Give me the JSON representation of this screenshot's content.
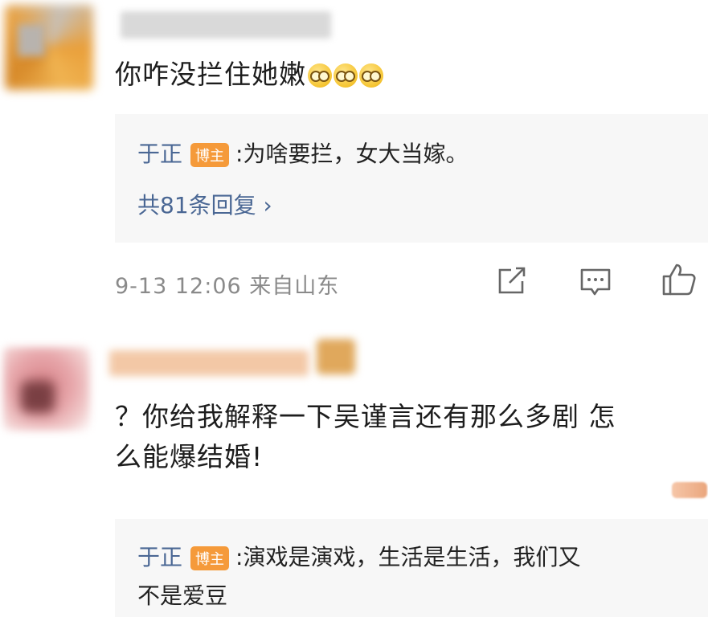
{
  "comment1": {
    "text": "你咋没拦住她嫩",
    "emoji_count": 3,
    "reply": {
      "author": "于正",
      "tag": "博主",
      "text": ":为啥要拦，女大当嫁。"
    },
    "more_replies": "共81条回复 ›",
    "timestamp": "9-13 12:06 来自山东"
  },
  "comment2": {
    "line1": "？你给我解释一下吴谨言还有那么多剧 怎",
    "line2": "么能爆结婚!",
    "reply": {
      "author": "于正",
      "tag": "博主",
      "line1": ":演戏是演戏，生活是生活，我们又",
      "line2": "不是爱豆"
    }
  },
  "icons": [
    "share-icon",
    "comment-icon",
    "like-icon"
  ],
  "colors": {
    "reply_name": "#4a6794",
    "host_tag": "#f59a3a",
    "meta": "#8a8a8a"
  }
}
